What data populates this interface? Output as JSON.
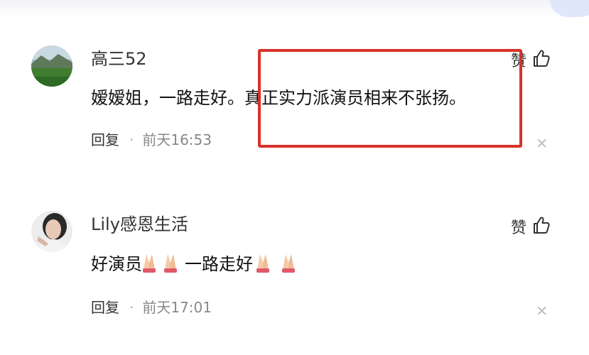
{
  "comments": [
    {
      "username": "高三52",
      "content": "嫒嫒姐，一路走好。真正实力派演员相来不张扬。",
      "reply_label": "回复",
      "separator": "·",
      "timestamp": "前天16:53",
      "like_label": "赞",
      "like_icon": "thumbs-up-icon",
      "close_icon": "close-icon",
      "avatar": "landscape-avatar"
    },
    {
      "username": "Lily感恩生活",
      "content_parts": [
        "好演员",
        "一路走好"
      ],
      "emoji": "folded-hands-emoji",
      "reply_label": "回复",
      "separator": "·",
      "timestamp": "前天17:01",
      "like_label": "赞",
      "like_icon": "thumbs-up-icon",
      "close_icon": "close-icon",
      "avatar": "portrait-avatar"
    }
  ],
  "colors": {
    "highlight_border": "#d9312a",
    "timestamp": "#888888",
    "close_icon": "#bbbbbb"
  }
}
